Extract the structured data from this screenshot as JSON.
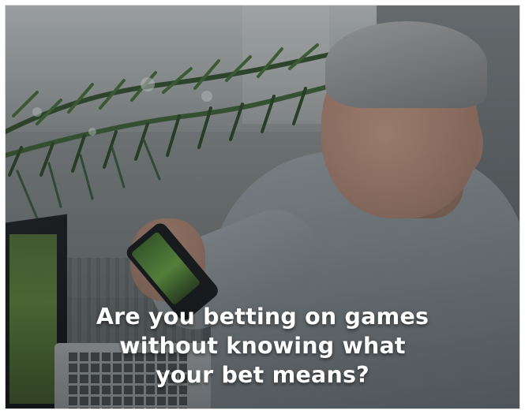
{
  "headline": {
    "lines": [
      "Are you betting on games",
      "without knowing what",
      "your bet means?"
    ]
  },
  "palette": {
    "text": "#ffffff",
    "backdrop": "#61676a",
    "sweater": "#858d92",
    "garland": "#2f4a2c",
    "phone_screen": "#66a043"
  }
}
